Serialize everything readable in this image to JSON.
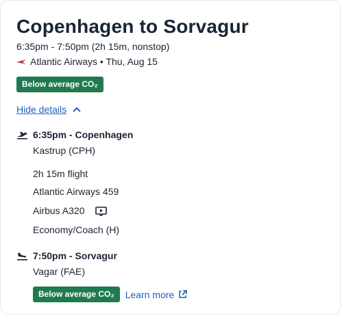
{
  "flight": {
    "title": "Copenhagen to Sorvagur",
    "summary": "6:35pm - 7:50pm (2h 15m, nonstop)",
    "airline_date": "Atlantic Airways • Thu, Aug 15",
    "co2_badge": "Below average CO₂",
    "hide_details": "Hide details"
  },
  "departure": {
    "time_city": "6:35pm - Copenhagen",
    "airport": "Kastrup (CPH)"
  },
  "details": {
    "duration": "2h 15m flight",
    "flight_number": "Atlantic Airways 459",
    "aircraft": "Airbus A320",
    "cabin": "Economy/Coach (H)"
  },
  "arrival": {
    "time_city": "7:50pm - Sorvagur",
    "airport": "Vagar (FAE)"
  },
  "footer": {
    "co2_badge": "Below average CO₂",
    "learn_more": "Learn more"
  },
  "colors": {
    "badge": "#1f7a4f",
    "link": "#1f5fbf",
    "text": "#1a2433"
  },
  "icons": {
    "airline": "airline-logo-icon",
    "collapse": "chevron-up-icon",
    "departure": "plane-takeoff-icon",
    "arrival": "plane-landing-icon",
    "entertainment": "screen-play-icon",
    "external": "external-link-icon"
  }
}
